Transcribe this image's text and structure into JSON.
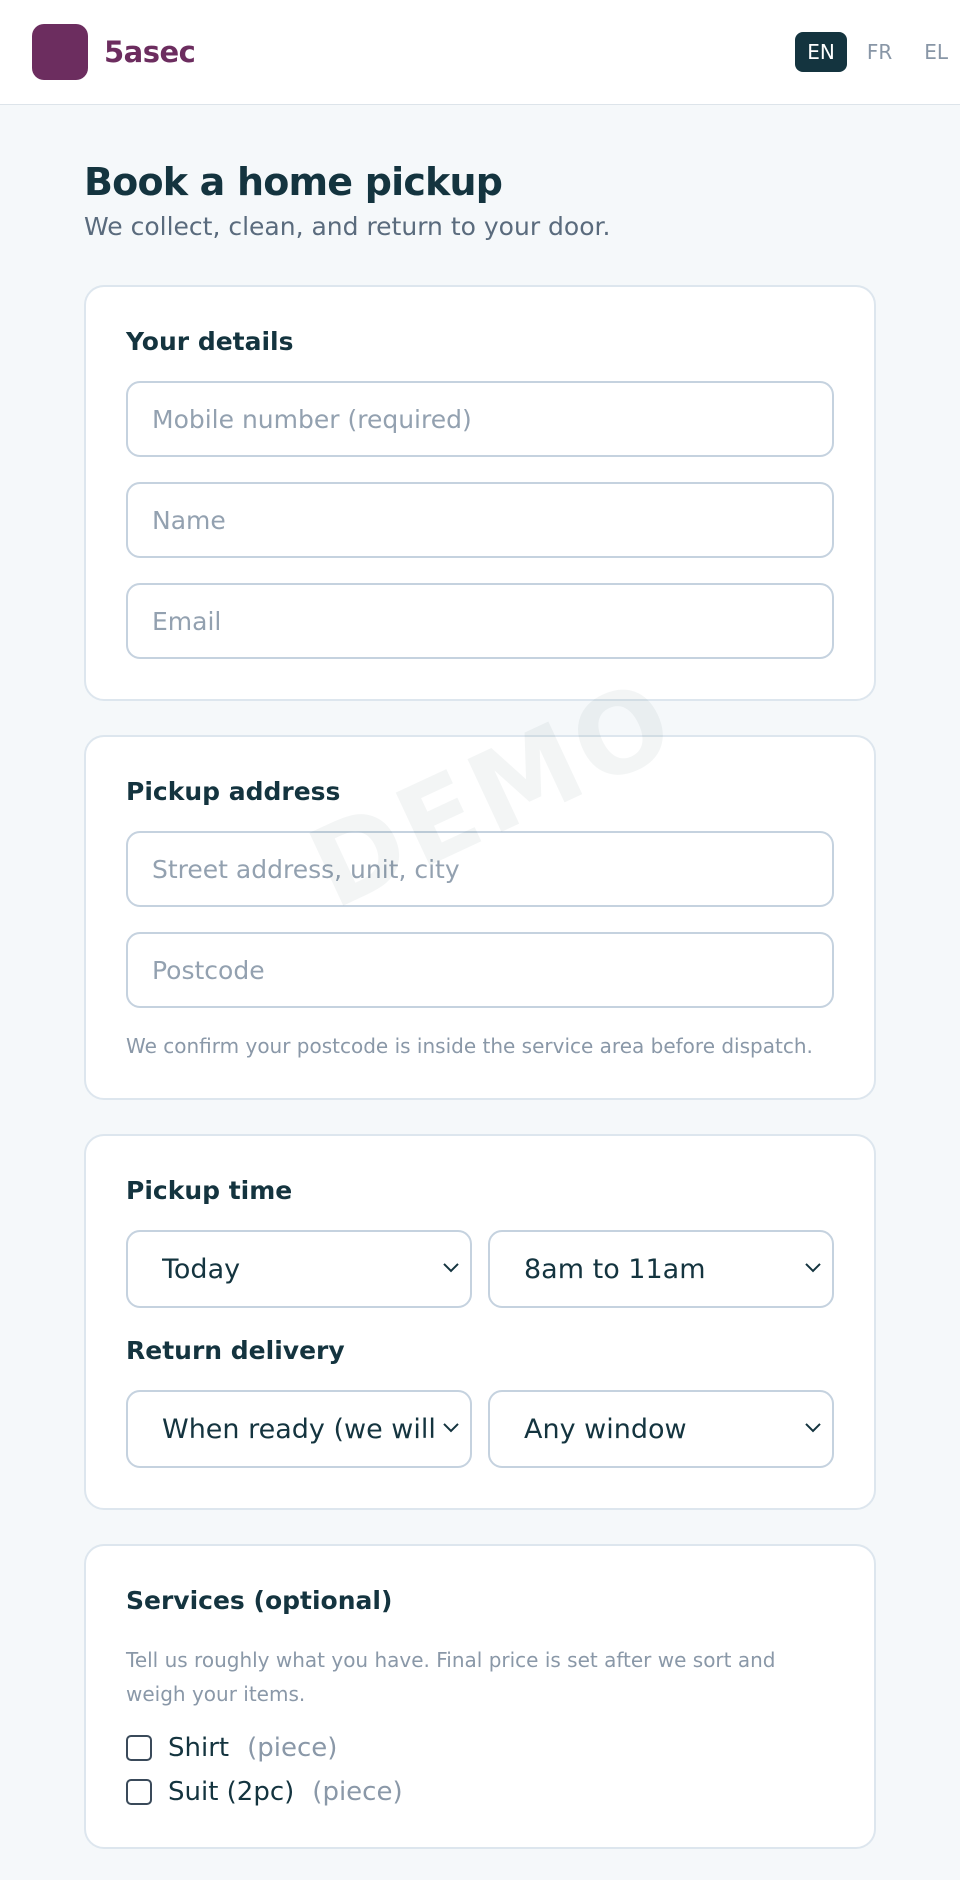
{
  "header": {
    "brand_name": "5asec",
    "brand_color": "#6c2d5f",
    "languages": [
      "EN",
      "FR",
      "EL"
    ],
    "active_language": "EN"
  },
  "page": {
    "title": "Book a home pickup",
    "subtitle": "We collect, clean, and return to your door."
  },
  "details": {
    "title": "Your details",
    "mobile_placeholder": "Mobile number (required)",
    "name_placeholder": "Name",
    "email_placeholder": "Email"
  },
  "address": {
    "title": "Pickup address",
    "street_placeholder": "Street address, unit, city",
    "postcode_placeholder": "Postcode",
    "hint": "We confirm your postcode is inside the service area before dispatch."
  },
  "time": {
    "pickup_title": "Pickup time",
    "pickup_day": "Today",
    "pickup_window": "8am to 11am",
    "return_title": "Return delivery",
    "return_day": "When ready (we will text)",
    "return_window": "Any window"
  },
  "services": {
    "title": "Services (optional)",
    "description": "Tell us roughly what you have. Final price is set after we sort and weigh your items.",
    "items": [
      {
        "label": "Shirt",
        "unit": "(piece)"
      },
      {
        "label": "Suit (2pc)",
        "unit": "(piece)"
      }
    ]
  },
  "watermark": "DEMO",
  "icons": {
    "select": "chevron-down-icon",
    "checkbox": "checkbox-icon"
  }
}
